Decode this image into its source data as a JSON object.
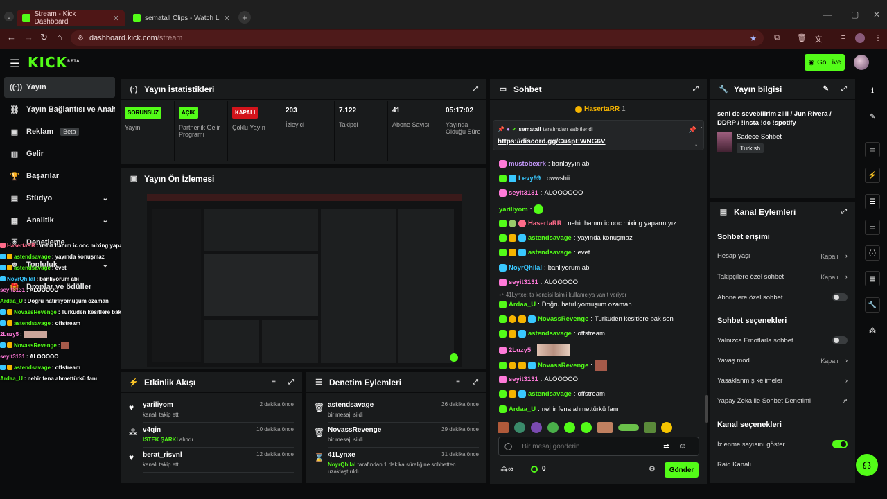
{
  "browser": {
    "tabs": [
      {
        "label": "Stream - Kick Dashboard"
      },
      {
        "label": "sematall Clips - Watch Live on K"
      }
    ],
    "url_host": "dashboard.kick.com",
    "url_path": "/stream"
  },
  "header": {
    "logo": "KICK",
    "logo_tag": "BETA",
    "go_live": "Go Live"
  },
  "sidebar": {
    "items": [
      {
        "label": "Yayın"
      },
      {
        "label": "Yayın Bağlantısı ve Anahtar"
      },
      {
        "label": "Reklam",
        "badge": "Beta"
      },
      {
        "label": "Gelir"
      },
      {
        "label": "Başarılar"
      },
      {
        "label": "Stüdyo"
      },
      {
        "label": "Analitik"
      },
      {
        "label": "Denetleme"
      },
      {
        "label": "Topluluk"
      },
      {
        "label": "Droplar ve ödüller"
      }
    ]
  },
  "overlay_chat": [
    {
      "user": "HasertaRR",
      "text": "nehir hanım ic ooc mixing yaparmıyız",
      "color": "#ff6b8a"
    },
    {
      "user": "astendsavage",
      "text": "yayında konuşmaz",
      "color": "#53fc18"
    },
    {
      "user": "astendsavage",
      "text": "evet",
      "color": "#53fc18"
    },
    {
      "user": "NoyrQhilal",
      "text": "banliyorum abi",
      "color": "#39c8ff"
    },
    {
      "user": "seyit3131",
      "text": "ALOOOOO",
      "color": "#ff7ad9"
    },
    {
      "user": "Ardaa_U",
      "text": "Doğru hatırlıyomuşum ozaman",
      "color": "#53fc18"
    },
    {
      "user": "NovassRevenge",
      "text": "Turkuden kesitlere bak sen",
      "color": "#53fc18"
    },
    {
      "user": "astendsavage",
      "text": "offstream",
      "color": "#53fc18"
    },
    {
      "user": "2Luzy5",
      "text": "",
      "color": "#ff7ad9"
    },
    {
      "user": "NovassRevenge",
      "text": "",
      "color": "#53fc18"
    },
    {
      "user": "seyit3131",
      "text": "ALOOOOO",
      "color": "#ff7ad9"
    },
    {
      "user": "astendsavage",
      "text": "offstream",
      "color": "#53fc18"
    },
    {
      "user": "Ardaa_U",
      "text": "nehir fena ahmettürkü fanı",
      "color": "#53fc18"
    }
  ],
  "stats": {
    "title": "Yayın İstatistikleri",
    "items": [
      {
        "badge": "SORUNSUZ",
        "label": "Yayın"
      },
      {
        "badge": "AÇIK",
        "label": "Partnerlik Gelir Programı"
      },
      {
        "badge": "KAPALI",
        "label": "Çoklu Yayın"
      },
      {
        "value": "203",
        "label": "İzleyici"
      },
      {
        "value": "7.122",
        "label": "Takipçi"
      },
      {
        "value": "41",
        "label": "Abone Sayısı"
      },
      {
        "value": "05:17:02",
        "label": "Yayında Olduğu Süre"
      }
    ]
  },
  "preview": {
    "title": "Yayın Ön İzlemesi"
  },
  "activity": {
    "title": "Etkinlik Akışı",
    "rows": [
      {
        "user": "yariliyom",
        "sub": "kanalı takip etti",
        "time": "2 dakika önce"
      },
      {
        "user": "v4qin",
        "sub_strong": "İSTEK ŞARKI",
        "sub": " alındı",
        "time": "10 dakika önce"
      },
      {
        "user": "berat_risvnl",
        "sub": "kanalı takip etti",
        "time": "12 dakika önce"
      }
    ]
  },
  "moderation": {
    "title": "Denetim Eylemleri",
    "rows": [
      {
        "user": "astendsavage",
        "sub": "bir mesajı sildi",
        "time": "26 dakika önce"
      },
      {
        "user": "NovassRevenge",
        "sub": "bir mesajı sildi",
        "time": "29 dakika önce"
      },
      {
        "user": "41Lynxe",
        "sub_strong": "NoyrQhilal",
        "sub": " tarafından 1 dakika süreliğine sohbetten uzaklaştırıldı",
        "time": "31 dakika önce"
      }
    ]
  },
  "chat": {
    "title": "Sohbet",
    "top_gifter": "HasertaRR",
    "top_gifter_count": "1",
    "pinned_by_user": "sematall",
    "pinned_by_suffix": "tarafından sabitlendi",
    "pinned_link": "https://discord.gg/Cu4pEWNG6V",
    "reply_note": "41Lynxe: ta kendisi İsimli kullanıcıya yanıt veriyor",
    "messages": [
      {
        "user": "mustobexrk",
        "text": "banlayyın abi",
        "color": "#c89bff"
      },
      {
        "user": "Levy99",
        "text": "owwshii",
        "color": "#39c8ff"
      },
      {
        "user": "seyit3131",
        "text": "ALOOOOOO",
        "color": "#ff7ad9"
      },
      {
        "user": "yariliyom",
        "text": "",
        "color": "#53fc18"
      },
      {
        "user": "HasertaRR",
        "text": "nehir hanım ic ooc mixing yaparmıyız",
        "color": "#ff6b8a"
      },
      {
        "user": "astendsavage",
        "text": "yayında konuşmaz",
        "color": "#53fc18"
      },
      {
        "user": "astendsavage",
        "text": "evet",
        "color": "#53fc18"
      },
      {
        "user": "NoyrQhilal",
        "text": "banliyorum abi",
        "color": "#39c8ff"
      },
      {
        "user": "seyit3131",
        "text": "ALOOOOO",
        "color": "#ff7ad9"
      },
      {
        "user": "Ardaa_U",
        "text": "Doğru hatırlıyomuşum ozaman",
        "color": "#53fc18"
      },
      {
        "user": "NovassRevenge",
        "text": "Turkuden kesitlere bak sen",
        "color": "#53fc18"
      },
      {
        "user": "astendsavage",
        "text": "offstream",
        "color": "#53fc18"
      },
      {
        "user": "2Luzy5",
        "text": "",
        "color": "#ff7ad9"
      },
      {
        "user": "NovassRevenge",
        "text": "",
        "color": "#53fc18"
      },
      {
        "user": "seyit3131",
        "text": "ALOOOOO",
        "color": "#ff7ad9"
      },
      {
        "user": "astendsavage",
        "text": "offstream",
        "color": "#53fc18"
      },
      {
        "user": "Ardaa_U",
        "text": "nehir fena ahmettürkü fanı",
        "color": "#53fc18"
      }
    ],
    "input_placeholder": "Bir mesaj gönderin",
    "point_count": "0",
    "send_label": "Gönder"
  },
  "stream_info": {
    "title": "Yayın bilgisi",
    "stream_title": "seni de sevebilirim zilli / Jun Rivera / DDRP / !insta !dc !spotify",
    "category": "Sadece Sohbet",
    "language": "Turkish"
  },
  "channel_actions": {
    "title": "Kanal Eylemleri",
    "chat_access": "Sohbet erişimi",
    "account_age": {
      "label": "Hesap yaşı",
      "value": "Kapalı"
    },
    "followers_only": {
      "label": "Takipçilere özel sohbet",
      "value": "Kapalı"
    },
    "subs_only": {
      "label": "Abonelere özel sohbet"
    },
    "chat_options": "Sohbet seçenekleri",
    "emotes_only": {
      "label": "Yalnızca Emotlarla sohbet"
    },
    "slow_mode": {
      "label": "Yavaş mod",
      "value": "Kapalı"
    },
    "banned_words": {
      "label": "Yasaklanmış kelimeler"
    },
    "ai_moderation": {
      "label": "Yapay Zeka ile Sohbet Denetimi"
    },
    "channel_options": "Kanal seçenekleri",
    "show_viewers": {
      "label": "İzlenme sayısını göster"
    },
    "raid": {
      "label": "Raid Kanalı"
    }
  },
  "colors": {
    "accent": "#53fc18",
    "danger": "#d3141b",
    "panel": "#191b1c",
    "bg": "#0b0c0d"
  }
}
